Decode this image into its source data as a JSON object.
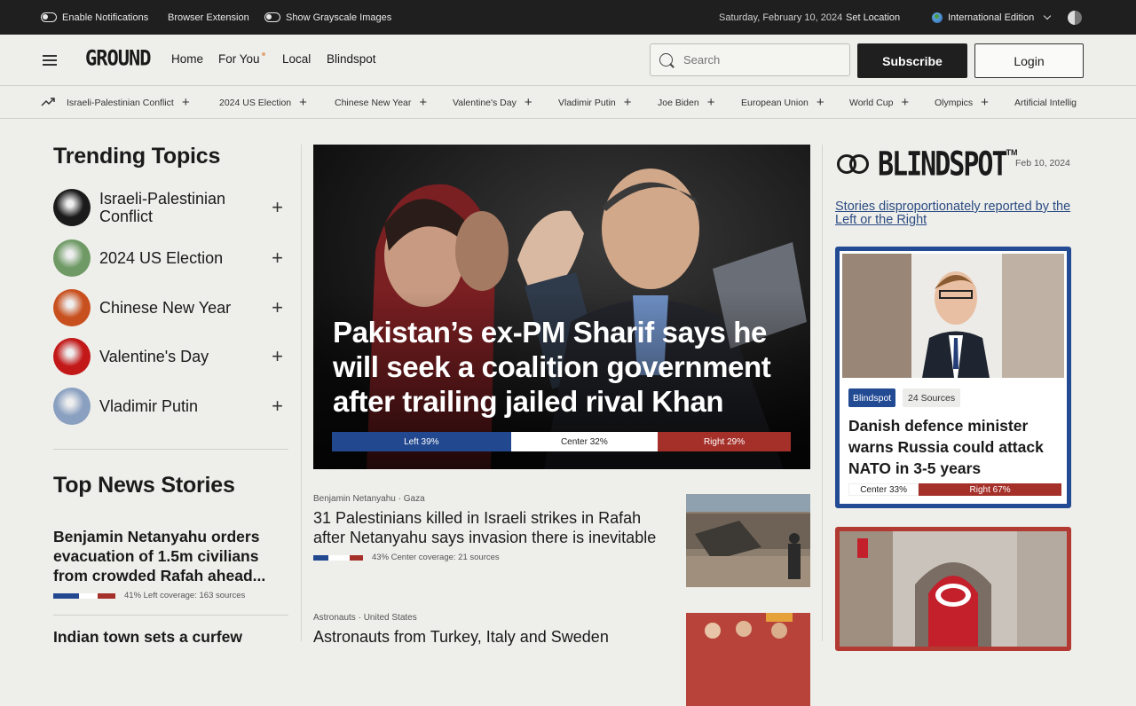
{
  "topbar": {
    "notifications": "Enable Notifications",
    "extension": "Browser Extension",
    "grayscale": "Show Grayscale Images",
    "date": "Saturday, February 10, 2024",
    "location": "Set Location",
    "edition": "International Edition"
  },
  "header": {
    "logo": "GROUND",
    "nav": [
      "Home",
      "For You",
      "Local",
      "Blindspot"
    ],
    "search_placeholder": "Search",
    "subscribe": "Subscribe",
    "login": "Login"
  },
  "topic_strip": [
    "Israeli-Palestinian Conflict",
    "2024 US Election",
    "Chinese New Year",
    "Valentine's Day",
    "Vladimir Putin",
    "Joe Biden",
    "European Union",
    "World Cup",
    "Olympics",
    "Artificial Intellig"
  ],
  "trending": {
    "title": "Trending Topics",
    "items": [
      {
        "label": "Israeli-Palestinian Conflict",
        "color": "#1b1b1b"
      },
      {
        "label": "2024 US Election",
        "color": "#6f9a66"
      },
      {
        "label": "Chinese New Year",
        "color": "#c8501e"
      },
      {
        "label": "Valentine's Day",
        "color": "#c21818"
      },
      {
        "label": "Vladimir Putin",
        "color": "#8aa0c0"
      }
    ]
  },
  "top_news": {
    "title": "Top News Stories",
    "stories": [
      {
        "headline": "Benjamin Netanyahu orders evacuation of 1.5m civilians from crowded Rafah ahead...",
        "coverage": "41% Left coverage: 163 sources",
        "split": [
          41,
          30,
          29
        ]
      },
      {
        "headline": "Indian town sets a curfew"
      }
    ]
  },
  "hero": {
    "title": "Pakistan’s ex-PM Sharif says he will seek a coalition government after trailing jailed rival Khan",
    "left": "Left 39%",
    "center": "Center 32%",
    "right": "Right 29%",
    "split": [
      39,
      32,
      29
    ]
  },
  "mid_stories": [
    {
      "meta": "Benjamin Netanyahu · Gaza",
      "headline": "31 Palestinians killed in Israeli strikes in Rafah after Netanyahu says invasion there is inevitable",
      "coverage": "43% Center coverage: 21 sources",
      "split": [
        30,
        43,
        27
      ]
    },
    {
      "meta": "Astronauts · United States",
      "headline": "Astronauts from Turkey, Italy and Sweden"
    }
  ],
  "blindspot": {
    "logo": "BLINDSPOT",
    "tm": "TM",
    "date": "Feb 10, 2024",
    "subtitle": "Stories disproportionately reported by the Left or the Right",
    "card": {
      "badge": "Blindspot",
      "sources": "24 Sources",
      "headline": "Danish defence minister warns Russia could attack NATO in 3-5 years",
      "center": "Center 33%",
      "right": "Right 67%",
      "split": [
        33,
        67
      ]
    }
  },
  "colors": {
    "left": "#22488f",
    "center": "#ffffff",
    "right": "#a5302a"
  }
}
